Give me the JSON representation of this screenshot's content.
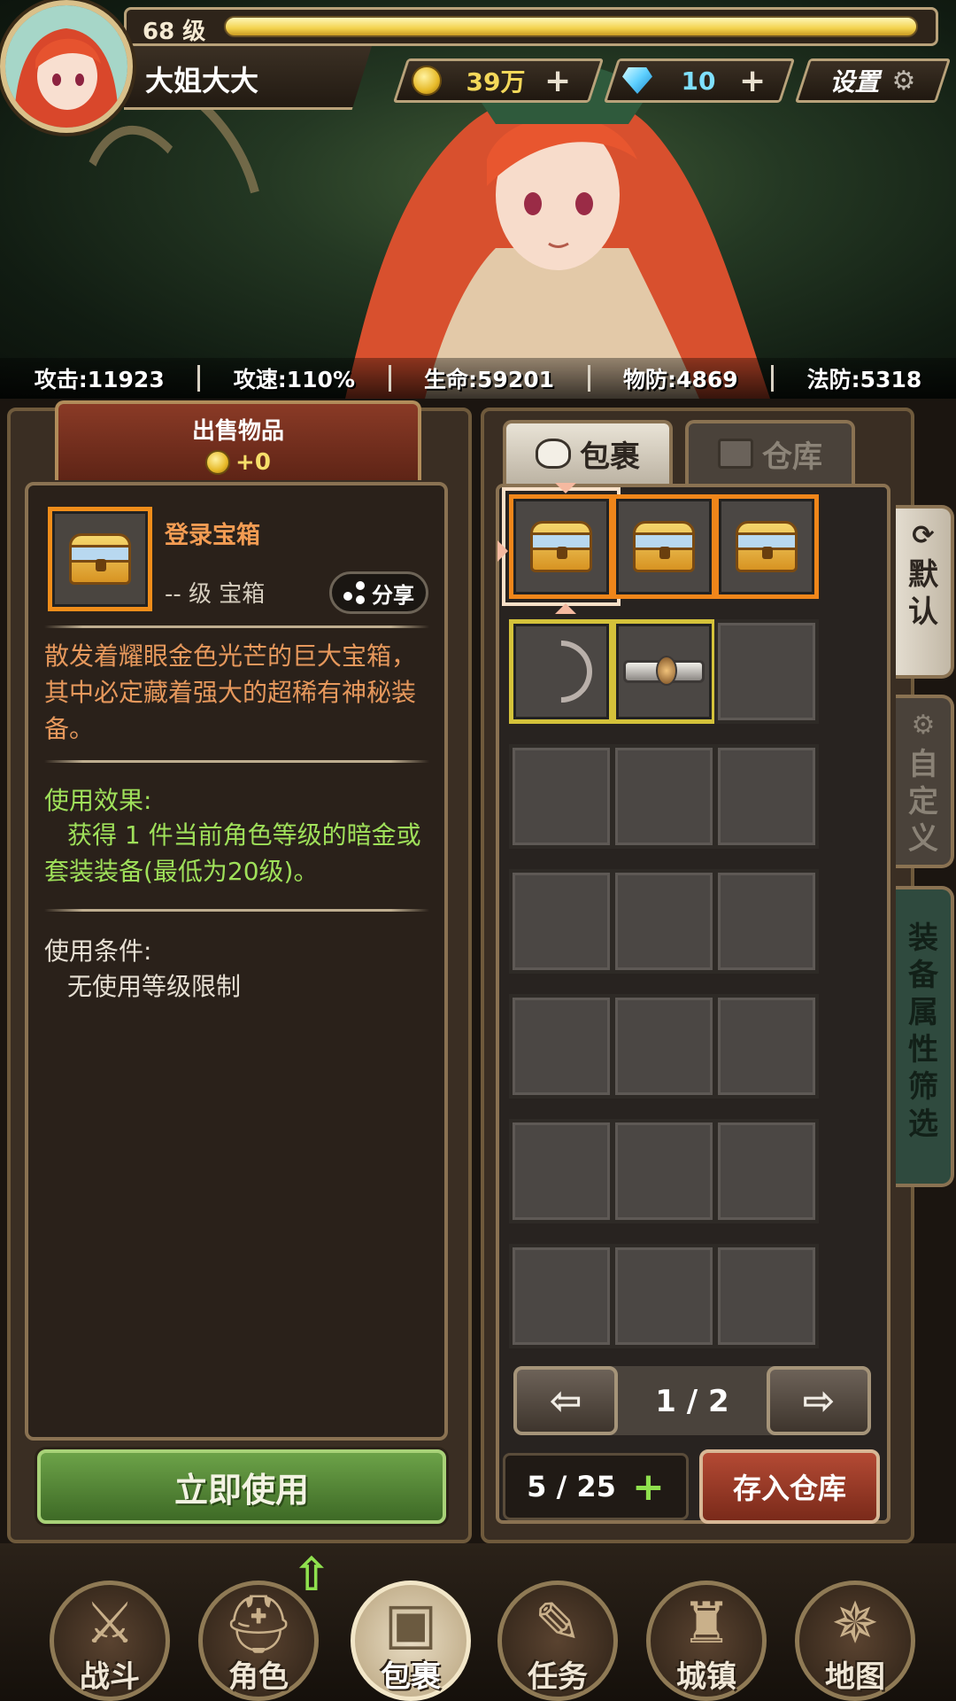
{
  "header": {
    "level": "68 级",
    "level_progress": 0.98,
    "player_name": "大姐大大",
    "gold": "39万",
    "diamonds": "10",
    "plus": "+",
    "settings_label": "设置"
  },
  "stats": [
    {
      "label": "攻击:11923"
    },
    {
      "label": "攻速:110%"
    },
    {
      "label": "生命:59201"
    },
    {
      "label": "物防:4869"
    },
    {
      "label": "法防:5318"
    }
  ],
  "sell": {
    "title": "出售物品",
    "value": "+0"
  },
  "item": {
    "name": "登录宝箱",
    "type": "-- 级 宝箱",
    "share_label": "分享",
    "description": "散发着耀眼金色光芒的巨大宝箱，其中必定藏着强大的超稀有神秘装备。",
    "effect_title": "使用效果:",
    "effect_text": "获得 1 件当前角色等级的暗金或套装装备(最低为20级)。",
    "condition_title": "使用条件:",
    "condition_text": "无使用等级限制",
    "use_label": "立即使用"
  },
  "bag_tabs": {
    "bag": "包裹",
    "warehouse": "仓库"
  },
  "side_tabs": {
    "default": "默认",
    "custom": "自定义",
    "filter": "装备属性筛选"
  },
  "inventory": {
    "slots": [
      "chest",
      "chest",
      "chest",
      "bow",
      "belt",
      "empty",
      "empty",
      "empty",
      "empty",
      "empty",
      "empty",
      "empty",
      "empty",
      "empty",
      "empty",
      "empty",
      "empty",
      "empty",
      "empty",
      "empty",
      "empty"
    ],
    "page": "1 / 2",
    "capacity": "5 / 25",
    "deposit_label": "存入仓库"
  },
  "nav": [
    {
      "label": "战斗",
      "icon": "crossed-swords-shield-icon"
    },
    {
      "label": "角色",
      "icon": "helmet-icon"
    },
    {
      "label": "包裹",
      "icon": "backpack-icon"
    },
    {
      "label": "任务",
      "icon": "scroll-icon"
    },
    {
      "label": "城镇",
      "icon": "tower-icon"
    },
    {
      "label": "地图",
      "icon": "map-icon"
    }
  ],
  "colors": {
    "rarity_orange": "#f0861a",
    "rarity_yellow": "#d4c23a",
    "effect_green": "#9fe05a",
    "description_orange": "#e6985c"
  }
}
